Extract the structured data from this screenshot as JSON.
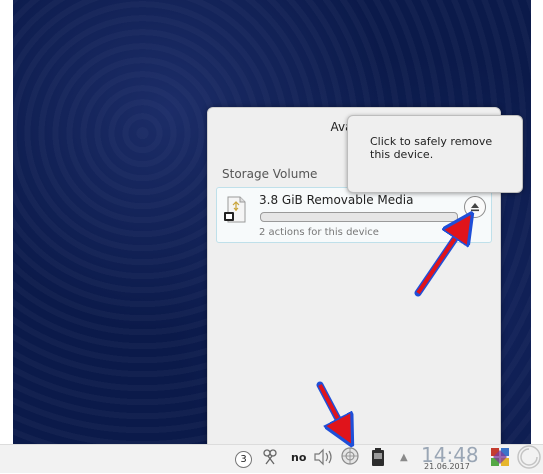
{
  "popup": {
    "title": "Availabl",
    "section_title": "Storage Volume",
    "device": {
      "name": "3.8 GiB Removable Media",
      "actions": "2 actions for this device",
      "usage_percent": 0
    }
  },
  "tooltip": {
    "text": "Click to safely remove this device."
  },
  "taskbar": {
    "keyboard_indicator": "3",
    "no_label": "no",
    "clock_time": "14:48",
    "clock_date": "21.06.2017"
  },
  "colors": {
    "desktop": "#0b1a4a",
    "annotation_arrow": "#e0141b",
    "annotation_arrow_outline": "#1f4fd8",
    "accent": "#3daee9"
  },
  "icons": [
    "usb-drive-icon",
    "eject-icon",
    "network-icon",
    "volume-icon",
    "device-notifier-icon",
    "battery-icon",
    "expand-tray-icon",
    "app-menu-icon"
  ]
}
